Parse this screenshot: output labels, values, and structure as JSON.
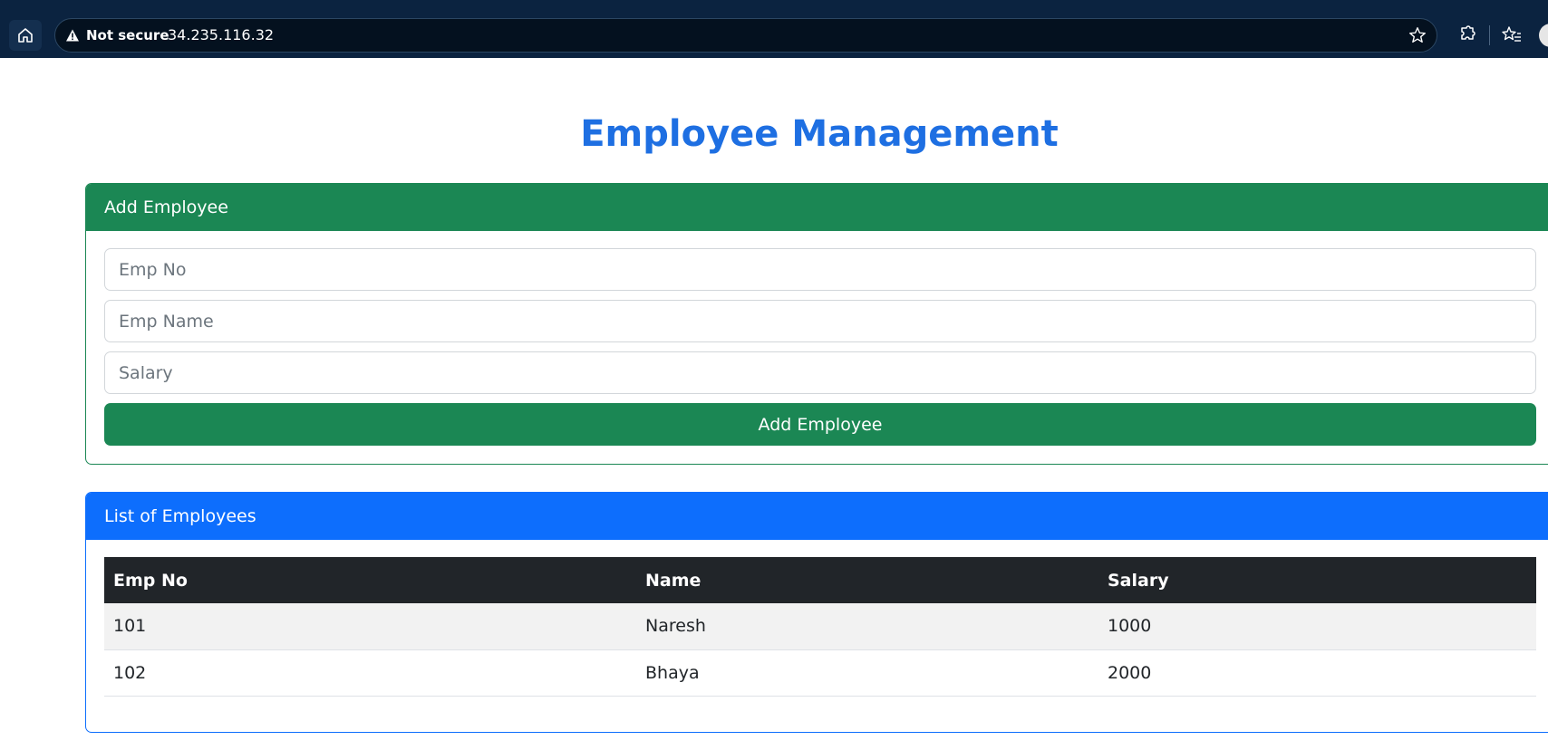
{
  "browser": {
    "security_label": "Not secure",
    "url": "34.235.116.32",
    "icons": [
      "home-icon",
      "warning-icon",
      "star-icon",
      "extensions-icon",
      "favorites-icon"
    ]
  },
  "page": {
    "title": "Employee Management"
  },
  "add_employee": {
    "header": "Add Employee",
    "fields": {
      "emp_no_placeholder": "Emp No",
      "emp_name_placeholder": "Emp Name",
      "salary_placeholder": "Salary"
    },
    "button_label": "Add Employee",
    "accent_color": "#1b8754"
  },
  "employee_list": {
    "header": "List of Employees",
    "accent_color": "#0d6efd",
    "columns": [
      "Emp No",
      "Name",
      "Salary"
    ],
    "rows": [
      [
        "101",
        "Naresh",
        "1000"
      ],
      [
        "102",
        "Bhaya",
        "2000"
      ]
    ]
  },
  "colors": {
    "title": "#1e6fe2",
    "table_header": "#212529",
    "browser_bar": "#0b2340"
  }
}
